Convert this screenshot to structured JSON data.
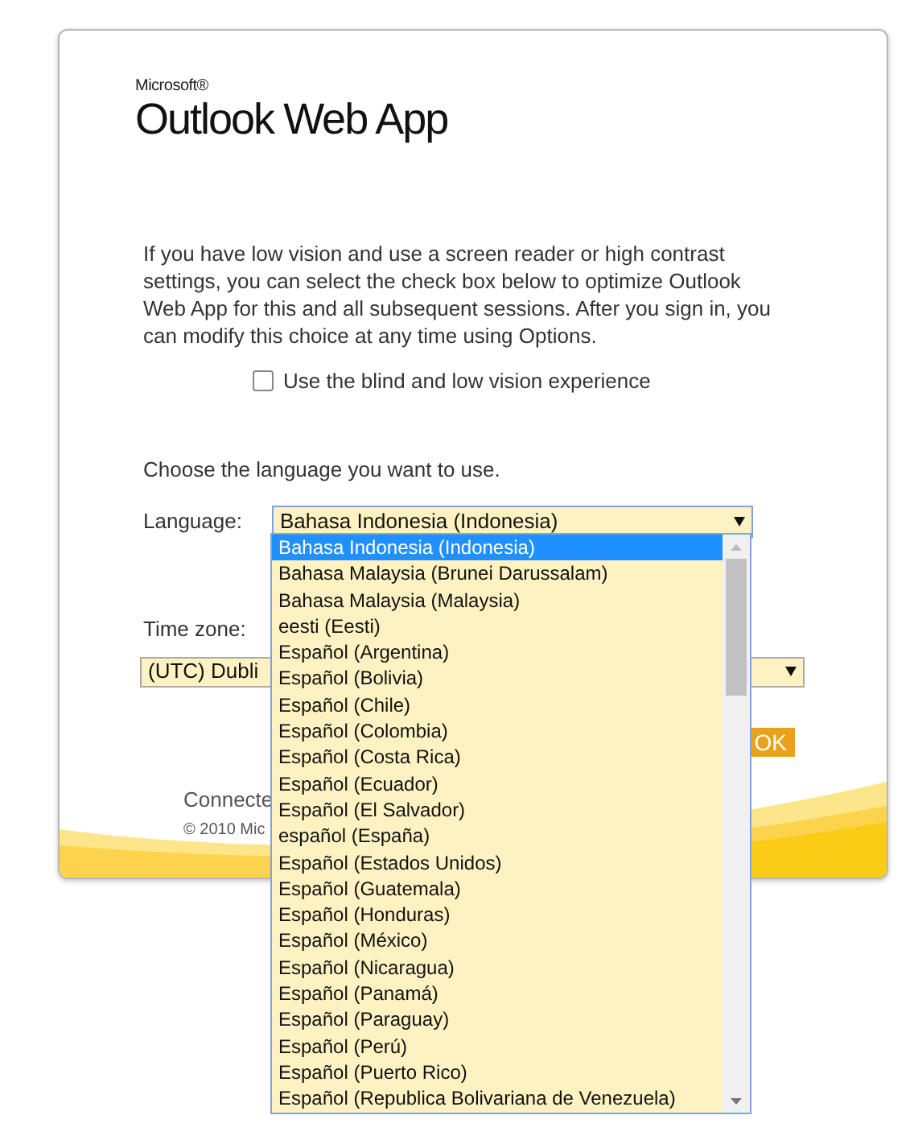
{
  "logo": {
    "brand": "Microsoft®",
    "product": "Outlook",
    "product_suffix": "Web App"
  },
  "intro": "If you have low vision and use a screen reader or high contrast settings, you can select the check box below to optimize Outlook Web App for this and all subsequent sessions. After you sign in, you can modify this choice at any time using Options.",
  "accessibility_option": {
    "label": "Use the blind and low vision experience",
    "checked": false
  },
  "language_prompt": "Choose the language you want to use.",
  "language": {
    "label": "Language:",
    "value": "Bahasa Indonesia (Indonesia)",
    "expanded": true,
    "options": [
      {
        "label": "Bahasa Indonesia (Indonesia)",
        "selected": true
      },
      {
        "label": "Bahasa Malaysia (Brunei Darussalam)",
        "selected": false
      },
      {
        "label": "Bahasa Malaysia (Malaysia)",
        "selected": false
      },
      {
        "label": "eesti (Eesti)",
        "selected": false
      },
      {
        "label": "Español (Argentina)",
        "selected": false
      },
      {
        "label": "Español (Bolivia)",
        "selected": false
      },
      {
        "label": "Español (Chile)",
        "selected": false
      },
      {
        "label": "Español (Colombia)",
        "selected": false
      },
      {
        "label": "Español (Costa Rica)",
        "selected": false
      },
      {
        "label": "Español (Ecuador)",
        "selected": false
      },
      {
        "label": "Español (El Salvador)",
        "selected": false
      },
      {
        "label": "español (España)",
        "selected": false
      },
      {
        "label": "Español (Estados Unidos)",
        "selected": false
      },
      {
        "label": "Español (Guatemala)",
        "selected": false
      },
      {
        "label": "Español (Honduras)",
        "selected": false
      },
      {
        "label": "Español (México)",
        "selected": false
      },
      {
        "label": "Español (Nicaragua)",
        "selected": false
      },
      {
        "label": "Español (Panamá)",
        "selected": false
      },
      {
        "label": "Español (Paraguay)",
        "selected": false
      },
      {
        "label": "Español (Perú)",
        "selected": false
      },
      {
        "label": "Español (Puerto Rico)",
        "selected": false
      },
      {
        "label": "Español (Republica Bolivariana de Venezuela)",
        "selected": false
      }
    ]
  },
  "time_zone": {
    "label": "Time zone:",
    "value": "(UTC) Dubli"
  },
  "ok_button": "OK",
  "footer": {
    "connected": "Connecte",
    "copyright": "© 2010 Mic"
  }
}
